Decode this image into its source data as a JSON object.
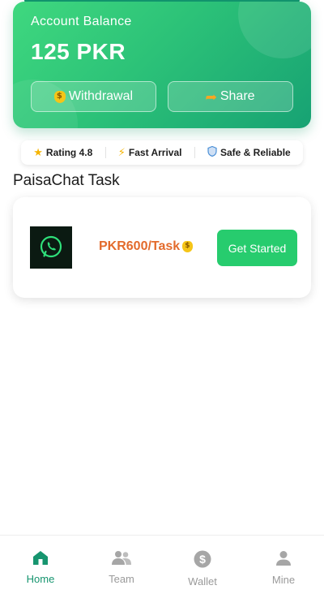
{
  "balance": {
    "label": "Account Balance",
    "amount": "125 PKR",
    "withdraw_label": "Withdrawal",
    "share_label": "Share"
  },
  "features": [
    {
      "icon": "star-icon",
      "label": "Rating 4.8"
    },
    {
      "icon": "lightning-icon",
      "label": "Fast Arrival"
    },
    {
      "icon": "shield-icon",
      "label": "Safe & Reliable"
    }
  ],
  "section": {
    "title": "PaisaChat Task"
  },
  "task": {
    "logo_icon": "whatsapp-icon",
    "price": "PKR600/Task",
    "button_label": "Get Started"
  },
  "nav": {
    "items": [
      {
        "label": "Home",
        "icon": "home-icon",
        "active": true
      },
      {
        "label": "Team",
        "icon": "team-icon",
        "active": false
      },
      {
        "label": "Wallet",
        "icon": "dollar-icon",
        "active": false
      },
      {
        "label": "Mine",
        "icon": "user-icon",
        "active": false
      }
    ]
  },
  "colors": {
    "brand_green": "#27cc6e",
    "dark_green": "#16956f",
    "price_orange": "#e36b2c"
  }
}
